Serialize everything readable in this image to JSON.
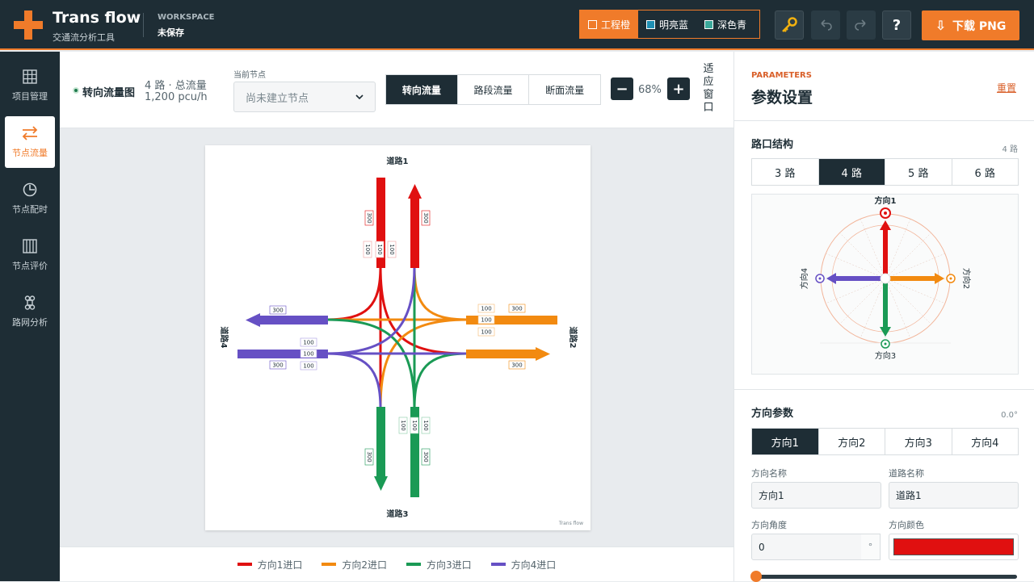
{
  "header": {
    "app_title": "Trans flow",
    "app_subtitle": "交通流分析工具",
    "workspace_label": "WORKSPACE",
    "workspace_status": "未保存",
    "themes": [
      {
        "label": "工程橙",
        "color": "#f07b2a",
        "active": true
      },
      {
        "label": "明亮蓝",
        "color": "#1f8fb3",
        "active": false
      },
      {
        "label": "深色青",
        "color": "#3aa89a",
        "active": false
      }
    ],
    "help_label": "?",
    "download_label": "下载 PNG"
  },
  "sidebar": {
    "items": [
      {
        "label": "项目管理",
        "icon": "grid-icon"
      },
      {
        "label": "节点流量",
        "icon": "swap-arrows-icon",
        "active": true
      },
      {
        "label": "节点配时",
        "icon": "clock-icon"
      },
      {
        "label": "节点评价",
        "icon": "columns-icon"
      },
      {
        "label": "路网分析",
        "icon": "command-icon"
      }
    ]
  },
  "toolbar": {
    "diagram_title": "转向流量图",
    "road_count": "4 路 · 总流量",
    "total_flow": "1,200 pcu/h",
    "node_label": "当前节点",
    "node_placeholder": "尚未建立节点",
    "view_tabs": [
      "转向流量",
      "路段流量",
      "断面流量"
    ],
    "zoom_value": "68%",
    "fit_label": "适应窗口"
  },
  "diagram": {
    "road_labels": [
      "道路1",
      "道路2",
      "道路3",
      "道路4"
    ],
    "entry_volume": "300",
    "turn_volume": "100",
    "watermark": "Trans flow",
    "colors": {
      "d1": "#e01010",
      "d2": "#f28a10",
      "d3": "#1a9a55",
      "d4": "#6650c4"
    }
  },
  "legend": {
    "items": [
      {
        "label": "方向1进口",
        "color": "#e01010"
      },
      {
        "label": "方向2进口",
        "color": "#f28a10"
      },
      {
        "label": "方向3进口",
        "color": "#1a9a55"
      },
      {
        "label": "方向4进口",
        "color": "#6650c4"
      }
    ]
  },
  "panel": {
    "eyebrow": "PARAMETERS",
    "title": "参数设置",
    "reset_label": "重置",
    "structure": {
      "title": "路口结构",
      "meta": "4 路",
      "options": [
        "3 路",
        "4 路",
        "5 路",
        "6 路"
      ],
      "active_index": 1,
      "direction_labels": [
        "方向1",
        "方向2",
        "方向3",
        "方向4"
      ]
    },
    "direction": {
      "title": "方向参数",
      "meta": "0.0°",
      "tabs": [
        "方向1",
        "方向2",
        "方向3",
        "方向4"
      ],
      "name_label": "方向名称",
      "name_value": "方向1",
      "road_label": "道路名称",
      "road_value": "道路1",
      "angle_label": "方向角度",
      "angle_value": "0",
      "angle_unit": "°",
      "color_label": "方向颜色",
      "color_value": "#e01010",
      "slider_value": 0
    }
  }
}
